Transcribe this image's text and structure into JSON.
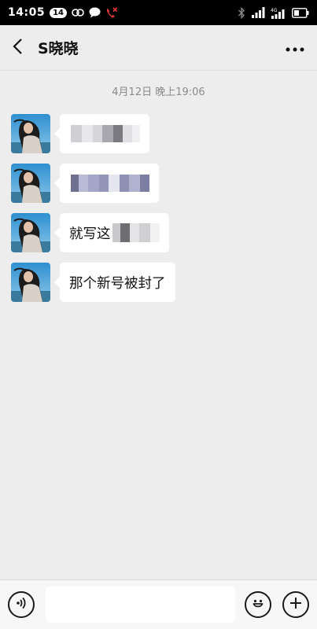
{
  "status_bar": {
    "time": "14:05",
    "badge": "14",
    "icons": [
      "link-icon",
      "chat-bubble-icon",
      "missed-call-icon"
    ],
    "right_icons": [
      "bluetooth-icon",
      "signal-icon",
      "signal-4g-icon",
      "battery-icon"
    ],
    "network_label": "4G",
    "missed_call_color": "#e53935"
  },
  "header": {
    "title": "S晓晓",
    "back_icon": "chevron-left-icon",
    "more_icon": "more-dots-icon"
  },
  "chat": {
    "timestamp": "4月12日 晚上19:06",
    "messages": [
      {
        "text_visible": "",
        "redacted": true
      },
      {
        "text_visible": "",
        "redacted": true
      },
      {
        "text_visible": "就写这",
        "redacted": true
      },
      {
        "text_visible": "那个新号被封了",
        "redacted": false
      }
    ]
  },
  "input_bar": {
    "voice_icon": "voice-icon",
    "emoji_icon": "emoji-icon",
    "add_icon": "plus-icon",
    "placeholder": ""
  },
  "colors": {
    "background": "#ededed",
    "bubble": "#ffffff",
    "timestamp": "#8a8a8a"
  }
}
